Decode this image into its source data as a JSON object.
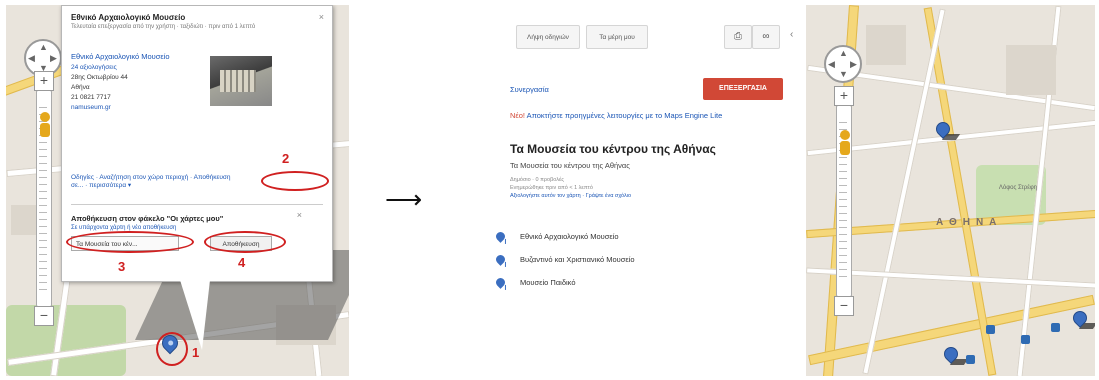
{
  "left_screenshot": {
    "popup": {
      "title": "Εθνικό Αρχαιολογικό Μουσείο",
      "subtitle": "Τελευταία επεξεργασία από την χρήστη · ταξιδιώτι · πριν από 1 λεπτό",
      "place_name": "Εθνικό Αρχαιολογικό Μουσείο",
      "reviews": "24 αξιολογήσεις",
      "address_line1": "28ης Οκτωβρίου 44",
      "address_line2": "Αθήνα",
      "phone": "21 0821 7717",
      "website": "namuseum.gr",
      "actions_line1": "Οδηγίες · Αναζήτηση στον χώρο περιοχή ·",
      "save_link": "Αποθήκευση",
      "actions_line2": "σε... · περισσότερα ▾",
      "save_title": "Αποθήκευση στον φάκελο \"Οι χάρτες μου\"",
      "save_subtitle": "Σε υπάρχοντα χάρτη ή νέο αποθήκευση",
      "select_value": "Τα Μουσεία του κέν...",
      "save_button": "Αποθήκευση",
      "close": "×"
    },
    "annotations": [
      "1",
      "2",
      "3",
      "4"
    ],
    "colors": {
      "annotation": "#d02020",
      "marker": "#3b6ec0"
    }
  },
  "arrow": "⟶",
  "right_panel": {
    "toolbar": {
      "btn1": "Λήψη οδηγιών",
      "btn2": "Τα μέρη μου",
      "print_icon": "print-icon",
      "link_icon": "link-icon",
      "collapse": "‹"
    },
    "collab_link": "Συνεργασία",
    "edit_button": "ΕΠΕΞΕΡΓΑΣΙΑ",
    "promo_new": "Νέο!",
    "promo_text": " Αποκτήστε προηγμένες λειτουργίες με το Maps Engine Lite",
    "map_title": "Τα Μουσεία του κέντρου της Αθήνας",
    "map_desc": "Τα Μουσεία του κέντρου της Αθήνας",
    "meta1": "Δημόσιο · 0 προβολές",
    "meta2": "Ενημερώθηκε πριν από < 1 λεπτό",
    "meta3": "Αξιολογήστε αυτόν τον χάρτη · Γράψτε ένα σχόλιο",
    "places": [
      "Εθνικό Αρχαιολογικό Μουσείο",
      "Βυζαντινό και Χριστιανικό Μουσείο",
      "Μουσείο Παιδικό"
    ],
    "edit_color": "#d14836"
  },
  "right_map": {
    "area_label": "ΑΘΗΝΑ",
    "small_label": "Λόφος Στρέφη"
  }
}
